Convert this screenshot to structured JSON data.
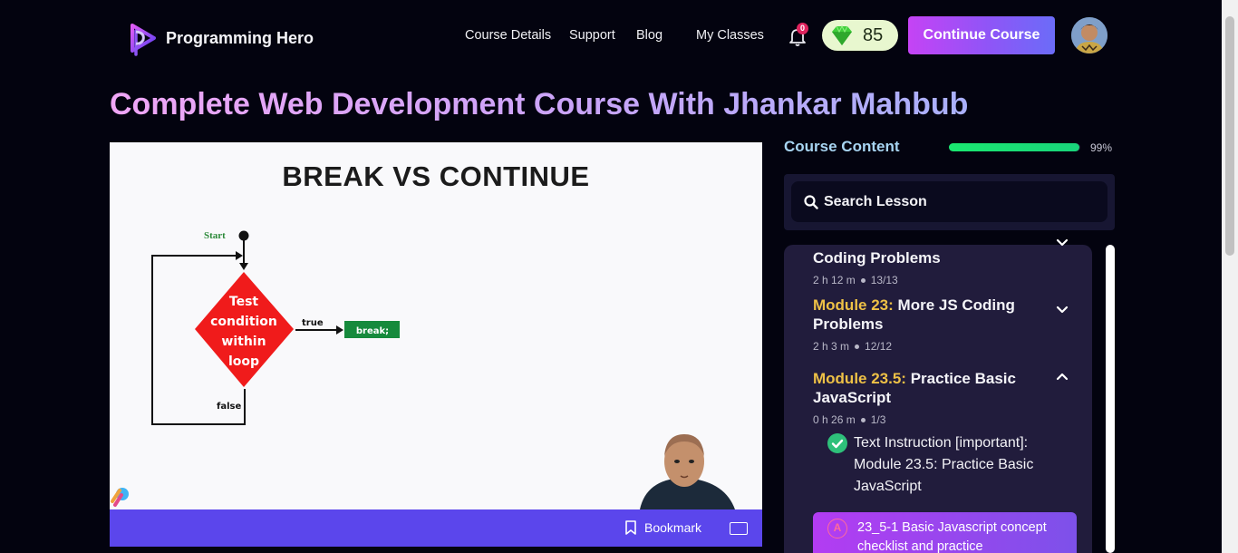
{
  "header": {
    "logo_text": "Programming Hero",
    "nav": [
      "Course Details",
      "Support",
      "Blog",
      "My Classes"
    ],
    "notification_count": "0",
    "gems": "85",
    "continue_label": "Continue Course"
  },
  "page_title": "Complete Web Development Course With Jhankar Mahbub",
  "video": {
    "slide_title": "BREAK VS CONTINUE",
    "flow_start": "Start",
    "flow_decision": [
      "Test",
      "condition",
      "within",
      "loop"
    ],
    "flow_true": "true",
    "flow_false": "false",
    "flow_action": "break;",
    "bookmark_label": "Bookmark"
  },
  "course_content": {
    "title": "Course Content",
    "progress_percent": 99,
    "progress_text": "99%",
    "search_placeholder": "Search Lesson",
    "modules": [
      {
        "prefix": "",
        "title": "Coding Problems",
        "duration": "2 h 12 m",
        "count": "13/13",
        "expanded": false
      },
      {
        "prefix": "Module 23:",
        "title": "More JS Coding Problems",
        "duration": "2 h 3 m",
        "count": "12/12",
        "expanded": false
      },
      {
        "prefix": "Module 23.5:",
        "title": "Practice Basic JavaScript",
        "duration": "0 h 26 m",
        "count": "1/3",
        "expanded": true
      }
    ],
    "lessons": [
      {
        "title": "Text Instruction [important]: Module 23.5: Practice Basic JavaScript",
        "status": "completed"
      },
      {
        "title": "23_5-1 Basic Javascript concept checklist and practice",
        "status": "active"
      }
    ]
  },
  "colors": {
    "accent_purple": "#5b46ec",
    "progress_green": "#1ae870",
    "module_prefix": "#eec146"
  }
}
